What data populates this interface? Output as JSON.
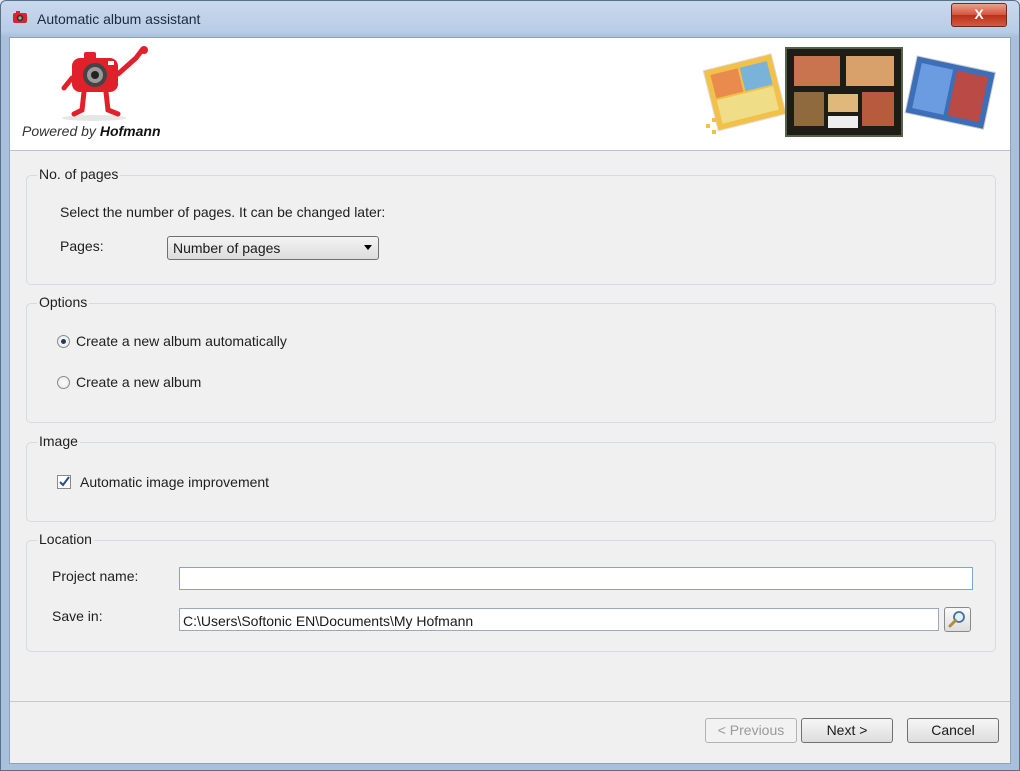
{
  "window": {
    "title": "Automatic album assistant",
    "close_label": "X"
  },
  "banner": {
    "powered_prefix": "Powered by",
    "powered_brand": "Hofmann"
  },
  "pages_group": {
    "legend": "No. of pages",
    "instruction": "Select the number of pages. It can be changed later:",
    "pages_label": "Pages:",
    "pages_select_value": "Number of pages"
  },
  "options_group": {
    "legend": "Options",
    "radio_auto_label": "Create a new album automatically",
    "radio_new_label": "Create a new album",
    "selected": "auto"
  },
  "image_group": {
    "legend": "Image",
    "checkbox_label": "Automatic image improvement",
    "checked": true
  },
  "location_group": {
    "legend": "Location",
    "project_name_label": "Project name:",
    "project_name_value": "",
    "save_in_label": "Save in:",
    "save_in_value": "C:\\Users\\Softonic EN\\Documents\\My Hofmann"
  },
  "footer": {
    "previous_label": "< Previous",
    "next_label": "Next >",
    "cancel_label": "Cancel"
  },
  "colors": {
    "title_bar": "#b9cde6",
    "close_red": "#c7402a",
    "brand_red": "#e0202a"
  }
}
